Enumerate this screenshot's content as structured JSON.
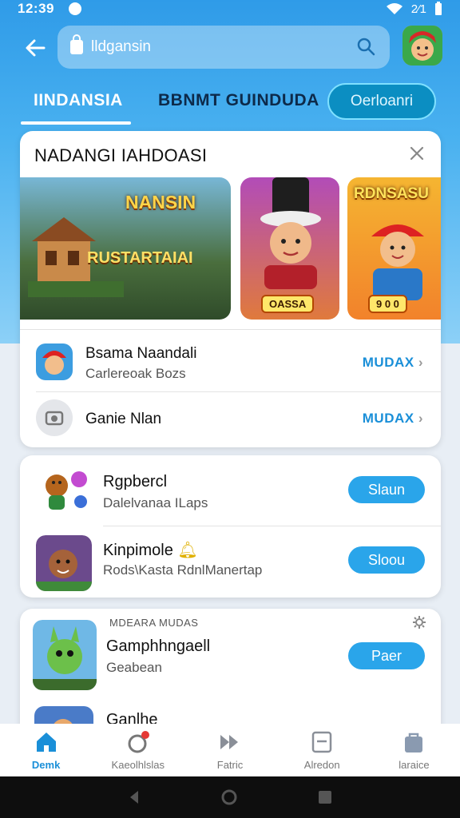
{
  "status_bar": {
    "time": "12:39",
    "right_text": "2⁄1"
  },
  "search": {
    "value": "lldgansin"
  },
  "tabs": [
    {
      "label": "IINDANSIA"
    },
    {
      "label": "BBNMT GUINDUDA"
    },
    {
      "label": "Oerloanri"
    }
  ],
  "featured": {
    "title": "NADANGI IAHDOASI",
    "banners": [
      {
        "title": "NANSIN",
        "subtitle": "RUSTARTAIAI"
      },
      {
        "badge": "OASSA"
      },
      {
        "title": "RDNSASU",
        "badge": "9 0 0"
      }
    ],
    "rows": [
      {
        "title": "Bsama Naandali",
        "subtitle": "Carlereoak Bozs",
        "action": "MUDAX"
      },
      {
        "title": "Ganie Nlan",
        "subtitle": "",
        "action": "MUDAX"
      }
    ]
  },
  "games": [
    {
      "title": "Rgpbercl",
      "subtitle": "Dalelvanaa ILaps",
      "button": "Slaun"
    },
    {
      "title": "Kinpimole",
      "subtitle": "Rods\\Kasta RdnlManertap",
      "button": "Sloou"
    }
  ],
  "section3": {
    "header": "MDEARA MUDAS",
    "rows": [
      {
        "title": "Gamphhngaell",
        "subtitle": "Geabean",
        "button": "Paer"
      },
      {
        "title": "Ganlhe"
      }
    ]
  },
  "bottom_nav": [
    {
      "label": "Demk"
    },
    {
      "label": "Kaeolhlslas"
    },
    {
      "label": "Fatric"
    },
    {
      "label": "Alredon"
    },
    {
      "label": "laraice"
    }
  ],
  "colors": {
    "accent": "#1a8fd8",
    "header_blue": "#2f9be8",
    "button_blue": "#2aa5ea"
  }
}
